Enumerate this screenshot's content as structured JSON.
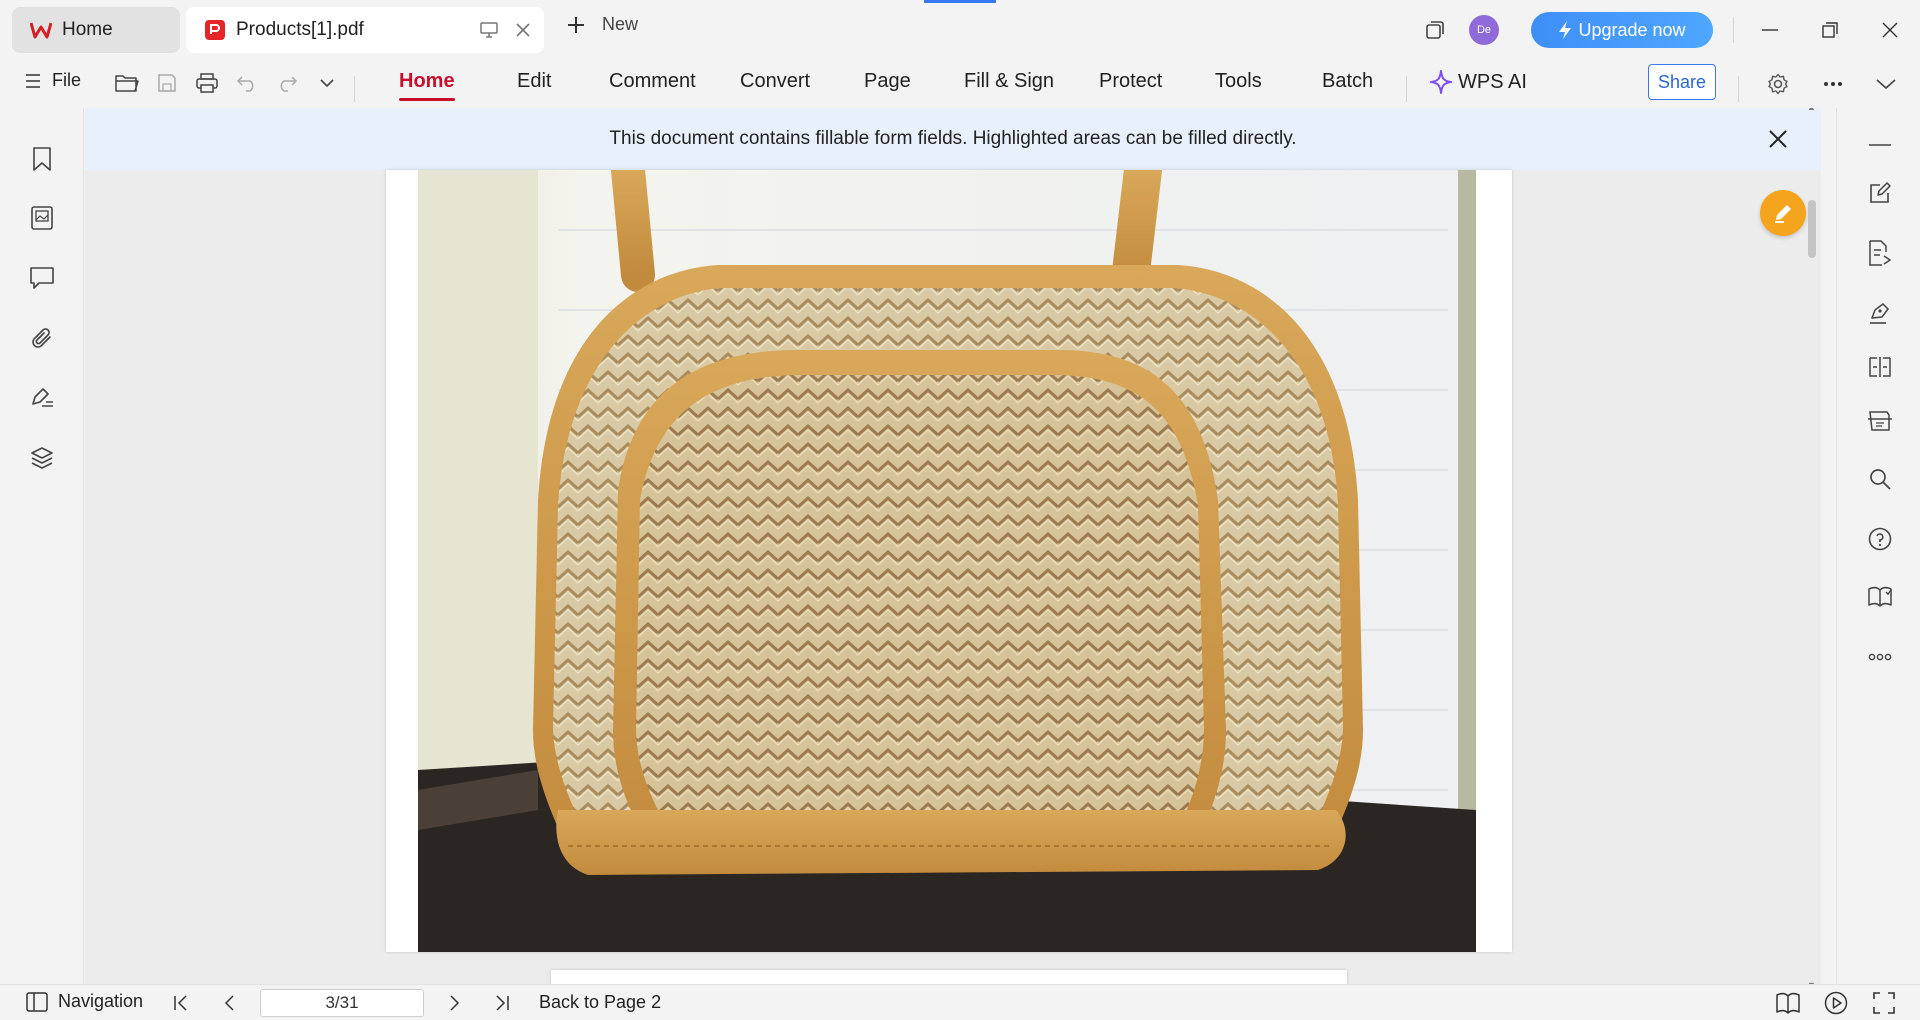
{
  "tabs": {
    "home_label": "Home",
    "doc_label": "Products[1].pdf",
    "new_label": "New"
  },
  "account": {
    "avatar_initials": "De",
    "upgrade_label": "Upgrade now"
  },
  "ribbon": {
    "file_label": "File",
    "menus": [
      "Home",
      "Edit",
      "Comment",
      "Convert",
      "Page",
      "Fill & Sign",
      "Protect",
      "Tools",
      "Batch"
    ],
    "active_menu": "Home",
    "ai_label": "WPS AI",
    "share_label": "Share"
  },
  "notice": {
    "text": "This document contains fillable form fields. Highlighted areas can be filled directly."
  },
  "statusbar": {
    "navigation_label": "Navigation",
    "page_value": "3/31",
    "back_label": "Back to Page 2"
  },
  "colors": {
    "accent_red": "#c8102e",
    "brand_blue": "#3a78f2",
    "fab_orange": "#f5a51d",
    "notice_bg": "#e8f0fb"
  },
  "icons": {
    "left_sidebar": [
      "bookmark-icon",
      "thumbnail-icon",
      "comment-icon",
      "attachment-icon",
      "signature-icon",
      "layers-icon"
    ],
    "right_sidebar": [
      "collapse-icon",
      "edit-note-icon",
      "extract-icon",
      "sign-pen-icon",
      "compare-icon",
      "scan-icon",
      "search-icon",
      "help-icon",
      "read-mode-icon",
      "more-icon"
    ]
  }
}
